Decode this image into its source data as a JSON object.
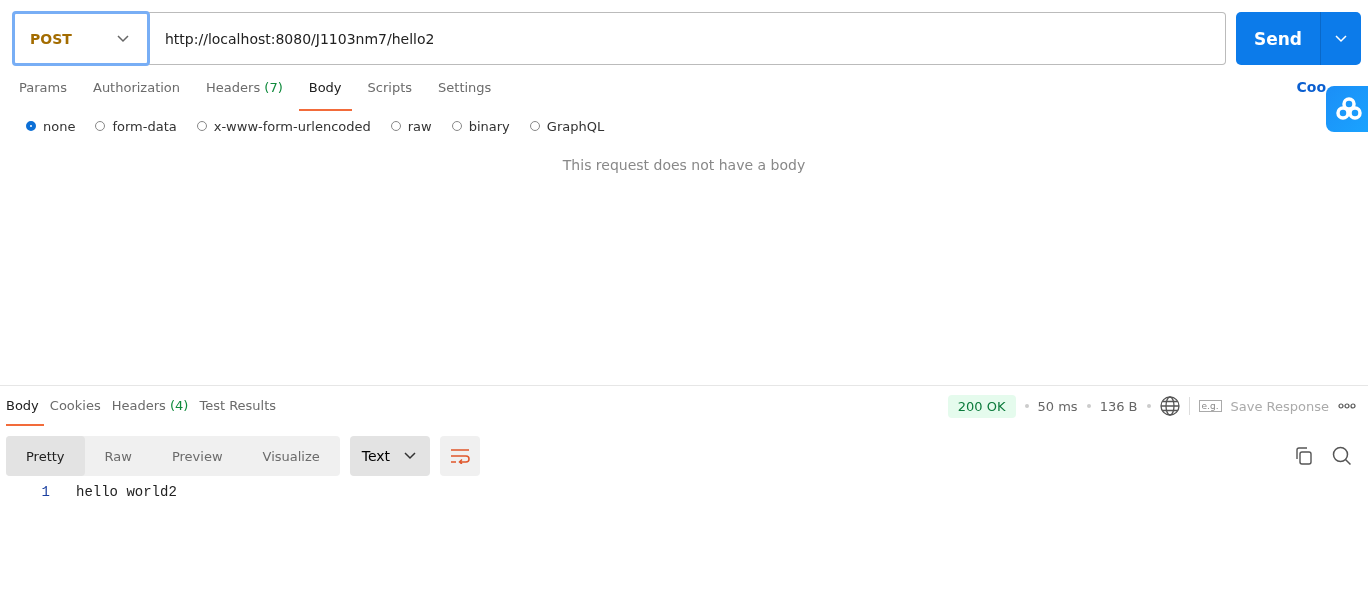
{
  "request": {
    "method": "POST",
    "url": "http://localhost:8080/J1103nm7/hello2",
    "send": "Send"
  },
  "request_tabs": [
    {
      "label": "Params",
      "selected": false
    },
    {
      "label": "Authorization",
      "selected": false
    },
    {
      "label": "Headers",
      "count": "(7)",
      "selected": false
    },
    {
      "label": "Body",
      "selected": true
    },
    {
      "label": "Scripts",
      "selected": false
    },
    {
      "label": "Settings",
      "selected": false
    }
  ],
  "cookies_link": "Coo",
  "body_types": [
    {
      "label": "none",
      "selected": true
    },
    {
      "label": "form-data",
      "selected": false
    },
    {
      "label": "x-www-form-urlencoded",
      "selected": false
    },
    {
      "label": "raw",
      "selected": false
    },
    {
      "label": "binary",
      "selected": false
    },
    {
      "label": "GraphQL",
      "selected": false
    }
  ],
  "empty_message": "This request does not have a body",
  "response_tabs": [
    {
      "label": "Body",
      "selected": true
    },
    {
      "label": "Cookies",
      "selected": false
    },
    {
      "label": "Headers",
      "count": "(4)",
      "selected": false
    },
    {
      "label": "Test Results",
      "selected": false
    }
  ],
  "response_meta": {
    "status": "200 OK",
    "time": "50 ms",
    "size": "136 B",
    "save_icon_text": "e.g.",
    "save": "Save Response"
  },
  "view_modes": [
    {
      "label": "Pretty",
      "selected": true
    },
    {
      "label": "Raw",
      "selected": false
    },
    {
      "label": "Preview",
      "selected": false
    },
    {
      "label": "Visualize",
      "selected": false
    }
  ],
  "format": "Text",
  "code_lines": [
    {
      "number": "1",
      "text": "hello world2"
    }
  ]
}
